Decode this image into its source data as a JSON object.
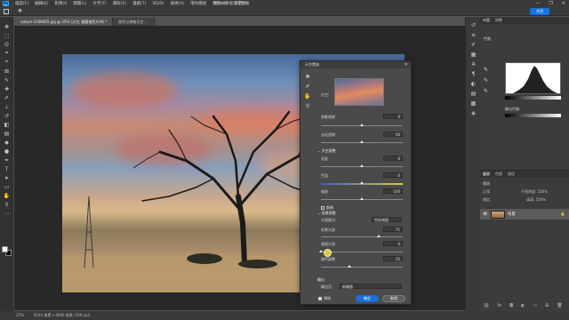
{
  "app": {
    "logo": "Ps",
    "window_title": "顏色以移動天空變換"
  },
  "menu": [
    "檔案(F)",
    "編輯(E)",
    "影像(I)",
    "圖層(L)",
    "文字(Y)",
    "選取(S)",
    "濾鏡(T)",
    "3D(D)",
    "檢視(V)",
    "增效模組",
    "視窗(W)",
    "說明(H)"
  ],
  "window_controls": [
    "—",
    "❐",
    "✕"
  ],
  "share_label": "共用",
  "doc_tabs": [
    {
      "label": "nature-1038465.jpg @ 25% (天空, 圖層遮色片/8) *"
    },
    {
      "label": "顏色以移動天空 …"
    }
  ],
  "statusbar": {
    "zoom": "25%",
    "size": "6144 像素 x 4096 像素 (300 ppi)"
  },
  "panels": {
    "histogram_tabs": [
      "內容",
      "調整"
    ],
    "histogram_label": "色階",
    "output_label": "輸出色階:",
    "layers_tabs": [
      "圖層",
      "色版",
      "路徑"
    ],
    "layer_name": "背景",
    "layer_filter": "種類",
    "layer_mode": "正常",
    "layer_opacity": "不透明度: 100%",
    "layer_lock": "鎖定:",
    "layer_fill": "填滿: 100%"
  },
  "dialog": {
    "title": "天空置換",
    "close": "✕",
    "preview_label": "天空:",
    "shift_edge_label": "移動邊緣",
    "shift_edge_value": "0",
    "fade_edge_label": "淡化邊緣",
    "fade_edge_value": "50",
    "sky_adj_label": "天空調整",
    "brightness_label": "亮度",
    "brightness_value": "0",
    "temperature_label": "色溫",
    "temperature_value": "0",
    "scale_label": "縮放",
    "scale_value": "100",
    "flip_label": "翻轉",
    "fg_adj_label": "前景調整",
    "light_mode_label": "光源模式:",
    "light_mode_value": "色彩增值",
    "fg_light_label": "前景光源",
    "fg_light_value": "71",
    "edge_light_label": "邊緣光源",
    "edge_light_value": "0",
    "color_adj_label": "顏色調整",
    "color_adj_value": "35",
    "output_label": "輸出",
    "output_to_label": "輸出至:",
    "output_to_value": "新圖層",
    "preview_check": "預視",
    "ok": "確定",
    "cancel": "取消"
  },
  "levels": {
    "shift_edge": 0.5,
    "fade_edge": 0.5,
    "brightness": 0.5,
    "temperature": 0.5,
    "scale": 0.5,
    "fg_light": 0.71,
    "edge_light": 0.0,
    "color_adj": 0.35
  },
  "colors": {
    "accent": "#1473e6",
    "ok": "#1a6fd8"
  }
}
